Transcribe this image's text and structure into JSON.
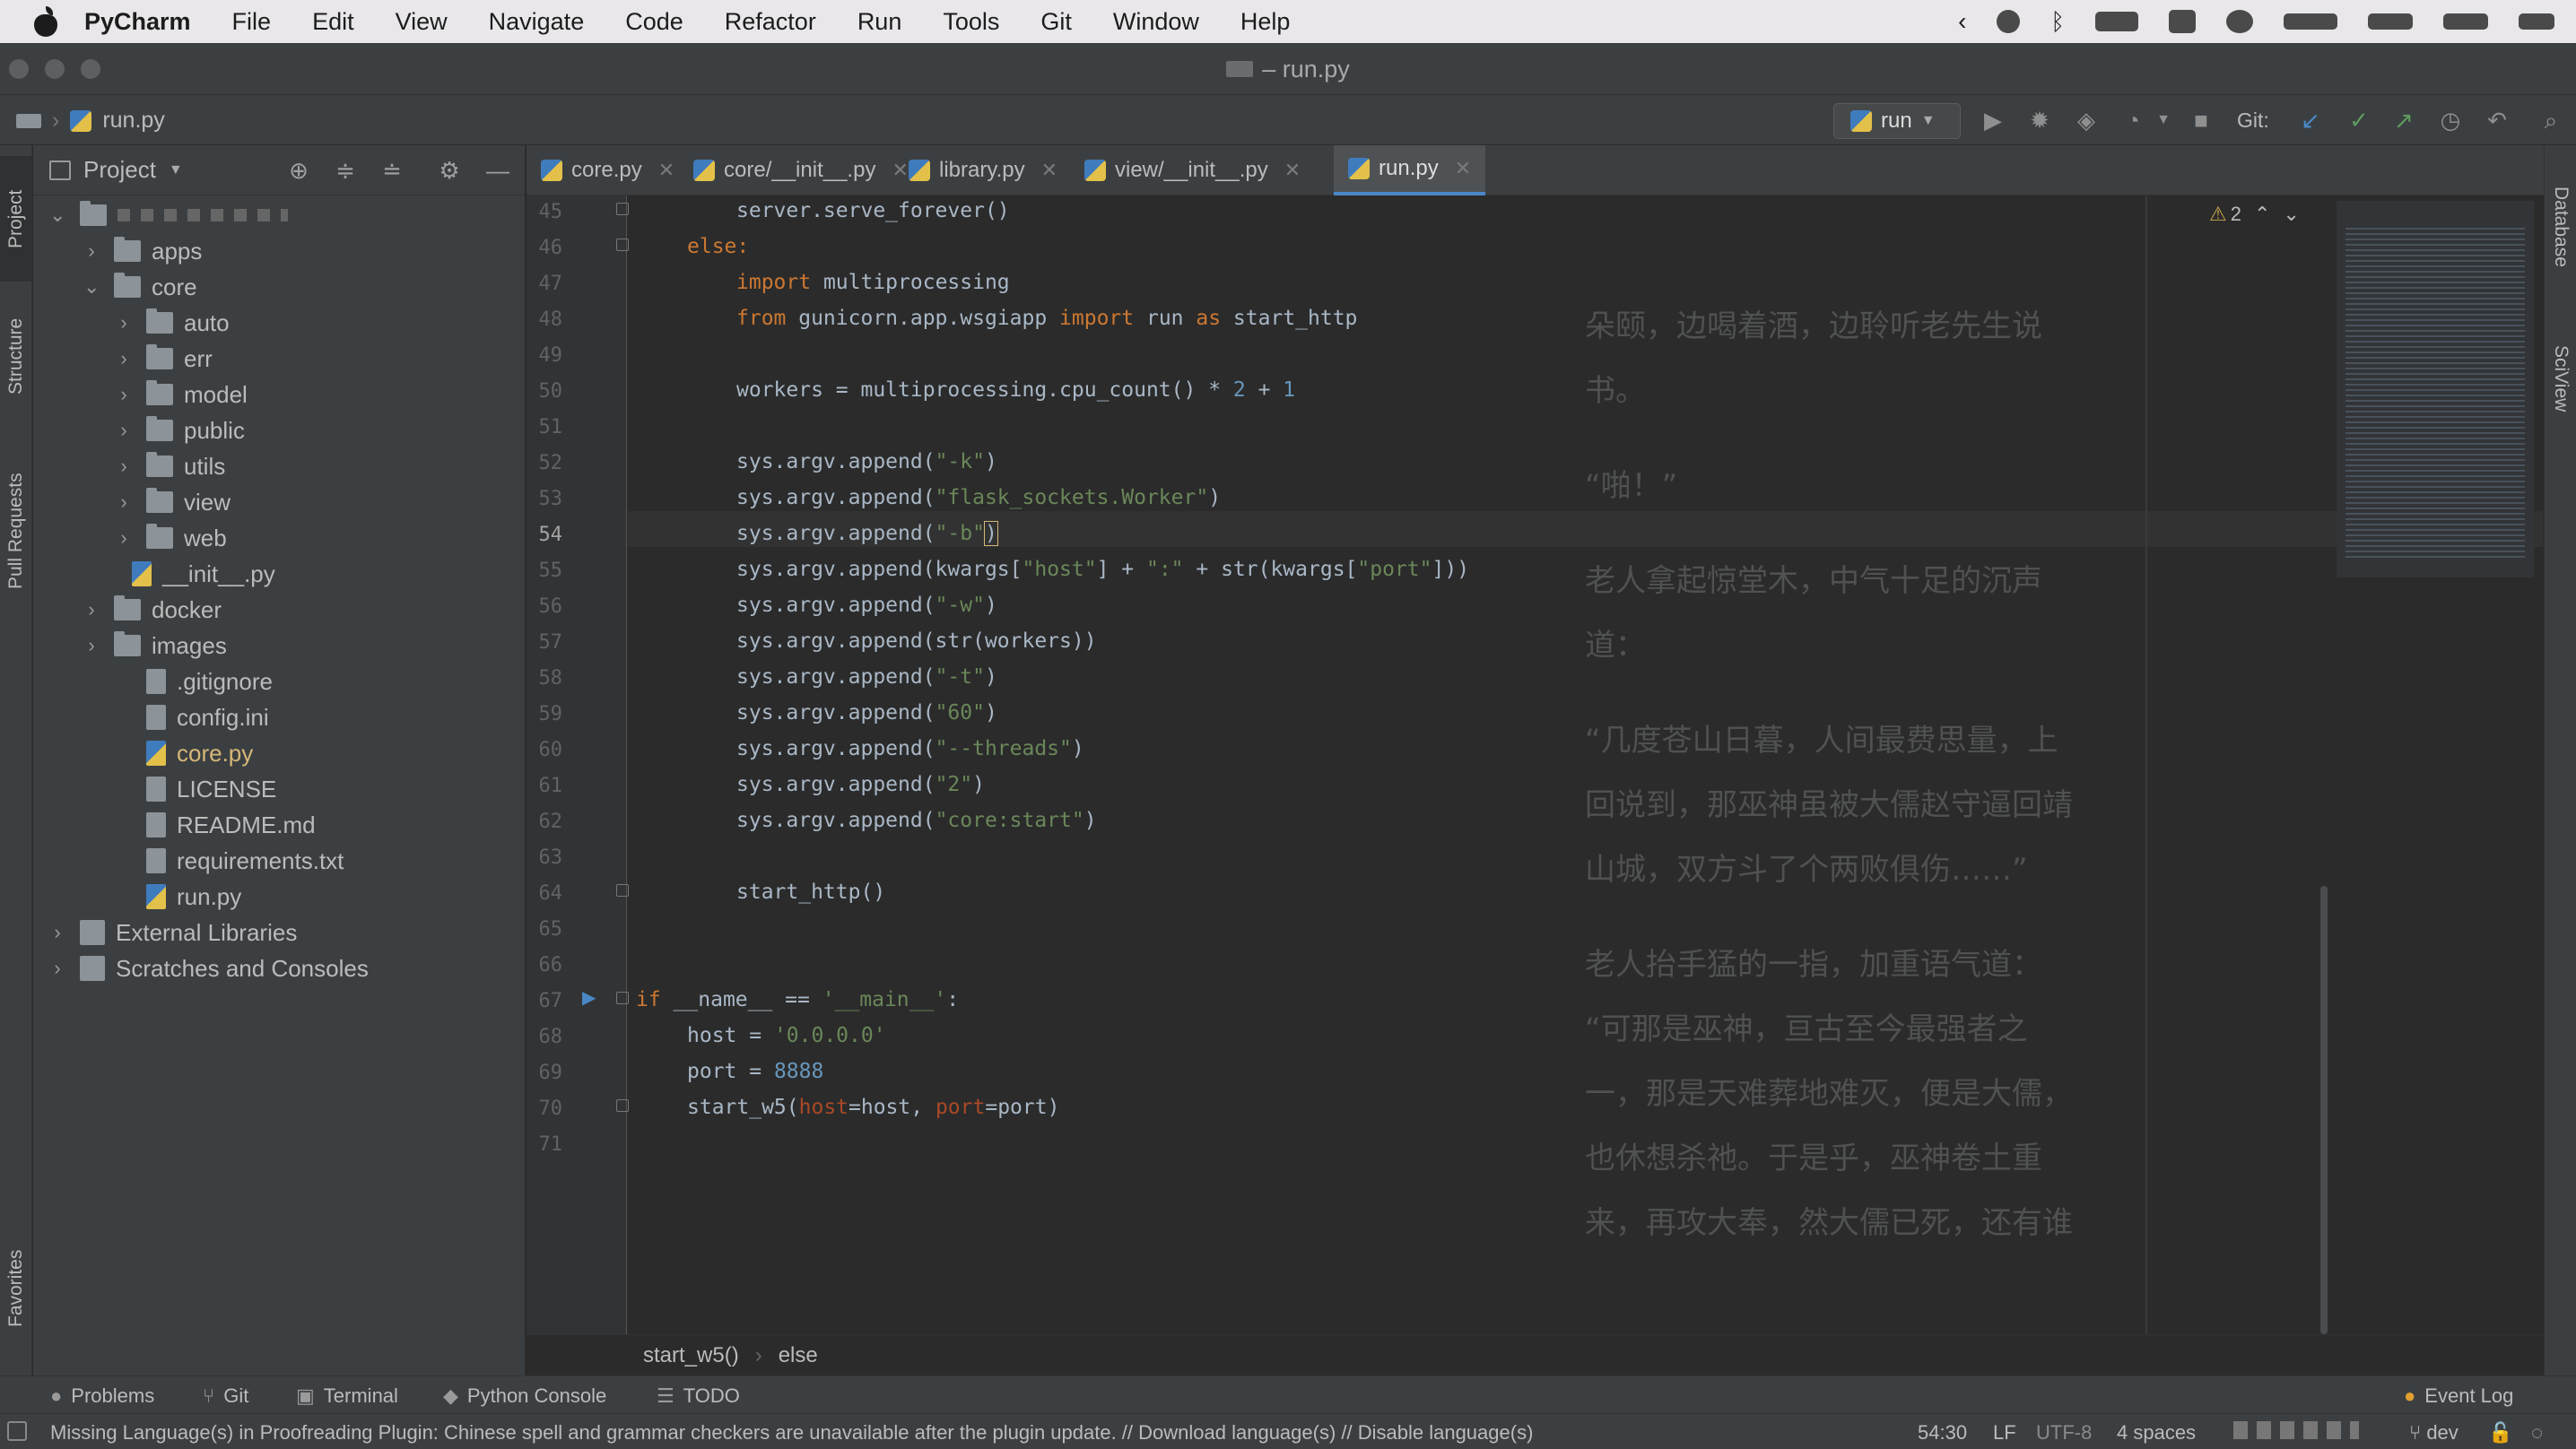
{
  "menubar": {
    "app": "PyCharm",
    "items": [
      "File",
      "Edit",
      "View",
      "Navigate",
      "Code",
      "Refactor",
      "Run",
      "Tools",
      "Git",
      "Window",
      "Help"
    ]
  },
  "window": {
    "title": "– run.py"
  },
  "navbar": {
    "crumb": "run.py",
    "run_config": "run",
    "git_label": "Git:"
  },
  "project": {
    "header": "Project",
    "tree": [
      {
        "label": "apps",
        "type": "folder",
        "depth": 1,
        "expanded": false
      },
      {
        "label": "core",
        "type": "folder",
        "depth": 1,
        "expanded": true
      },
      {
        "label": "auto",
        "type": "folder",
        "depth": 2,
        "expanded": false
      },
      {
        "label": "err",
        "type": "folder",
        "depth": 2,
        "expanded": false
      },
      {
        "label": "model",
        "type": "folder",
        "depth": 2,
        "expanded": false
      },
      {
        "label": "public",
        "type": "folder",
        "depth": 2,
        "expanded": false
      },
      {
        "label": "utils",
        "type": "folder",
        "depth": 2,
        "expanded": false
      },
      {
        "label": "view",
        "type": "folder",
        "depth": 2,
        "expanded": false
      },
      {
        "label": "web",
        "type": "folder",
        "depth": 2,
        "expanded": false
      },
      {
        "label": "__init__.py",
        "type": "py",
        "depth": 3
      },
      {
        "label": "docker",
        "type": "folder",
        "depth": 1,
        "expanded": false
      },
      {
        "label": "images",
        "type": "folder",
        "depth": 1,
        "expanded": false
      },
      {
        "label": ".gitignore",
        "type": "file",
        "depth": 2
      },
      {
        "label": "config.ini",
        "type": "file",
        "depth": 2
      },
      {
        "label": "core.py",
        "type": "py",
        "depth": 2,
        "modified": true
      },
      {
        "label": "LICENSE",
        "type": "file",
        "depth": 2
      },
      {
        "label": "README.md",
        "type": "file",
        "depth": 2
      },
      {
        "label": "requirements.txt",
        "type": "file",
        "depth": 2
      },
      {
        "label": "run.py",
        "type": "py",
        "depth": 2
      },
      {
        "label": "External Libraries",
        "type": "lib",
        "depth": 0,
        "expanded": false
      },
      {
        "label": "Scratches and Consoles",
        "type": "lib",
        "depth": 0,
        "expanded": false
      }
    ]
  },
  "tabs": [
    {
      "label": "core.py",
      "active": false
    },
    {
      "label": "core/__init__.py",
      "active": false
    },
    {
      "label": "library.py",
      "active": false
    },
    {
      "label": "view/__init__.py",
      "active": false
    },
    {
      "label": "run.py",
      "active": true
    }
  ],
  "editor": {
    "warnings": "2",
    "current_line": 54,
    "line_numbers": [
      45,
      46,
      47,
      48,
      49,
      50,
      51,
      52,
      53,
      54,
      55,
      56,
      57,
      58,
      59,
      60,
      61,
      62,
      63,
      64,
      65,
      66,
      67,
      68,
      69,
      70,
      71
    ],
    "overlay_text": [
      "朵颐，边喝着酒，边聆听老先生说",
      "书。",
      "“啪！”",
      "老人拿起惊堂木，中气十足的沉声",
      "道：",
      "“几度苍山日暮，人间最费思量，上",
      "回说到，那巫神虽被大儒赵守逼回靖",
      "山城，双方斗了个两败俱伤……”",
      "老人抬手猛的一指，加重语气道：",
      "“可那是巫神，亘古至今最强者之",
      "一，那是天难葬地难灭，便是大儒，",
      "也休想杀祂。于是乎，巫神卷土重",
      "来，再攻大奉，然大儒已死，还有谁"
    ]
  },
  "code_tokens": {
    "l45": "server.serve_forever()",
    "l46": "else:",
    "l47a": "import",
    "l47b": " multiprocessing",
    "l48a": "from",
    "l48b": " gunicorn.app.wsgiapp ",
    "l48c": "import",
    "l48d": " run ",
    "l48e": "as",
    "l48f": " start_http",
    "l50a": "workers = multiprocessing.cpu_count() * ",
    "l50b": "2",
    "l50c": " + ",
    "l50d": "1",
    "l52a": "sys.argv.append(",
    "l52b": "\"-k\"",
    "l52c": ")",
    "l53a": "sys.argv.append(",
    "l53b": "\"flask_sockets.Worker\"",
    "l53c": ")",
    "l54a": "sys.argv.append(",
    "l54b": "\"-b\"",
    "l54c": ")",
    "l55a": "sys.argv.append(kwargs[",
    "l55b": "\"host\"",
    "l55c": "] + ",
    "l55d": "\":\"",
    "l55e": " + str(kwargs[",
    "l55f": "\"port\"",
    "l55g": "]))",
    "l56a": "sys.argv.append(",
    "l56b": "\"-w\"",
    "l56c": ")",
    "l57": "sys.argv.append(str(workers))",
    "l58a": "sys.argv.append(",
    "l58b": "\"-t\"",
    "l58c": ")",
    "l59a": "sys.argv.append(",
    "l59b": "\"60\"",
    "l59c": ")",
    "l60a": "sys.argv.append(",
    "l60b": "\"--threads\"",
    "l60c": ")",
    "l61a": "sys.argv.append(",
    "l61b": "\"2\"",
    "l61c": ")",
    "l62a": "sys.argv.append(",
    "l62b": "\"core:start\"",
    "l62c": ")",
    "l64": "start_http()",
    "l67a": "if",
    "l67b": " __name__ == ",
    "l67c": "'__main__'",
    "l67d": ":",
    "l68a": "host = ",
    "l68b": "'0.0.0.0'",
    "l69a": "port = ",
    "l69b": "8888",
    "l70a": "start_w5(",
    "l70b": "host",
    "l70c": "=host, ",
    "l70d": "port",
    "l70e": "=port)"
  },
  "breadcrumbs": [
    "start_w5()",
    "else"
  ],
  "bottom_tools": [
    "Problems",
    "Git",
    "Terminal",
    "Python Console",
    "TODO"
  ],
  "event_log": "Event Log",
  "status": {
    "message": "Missing Language(s) in Proofreading Plugin: Chinese spell and grammar checkers are unavailable after the plugin update. // Download language(s) // Disable language(s)",
    "position": "54:30",
    "line_sep": "LF",
    "encoding": "UTF-8",
    "indent": "4 spaces",
    "branch": "dev"
  },
  "side_tabs": {
    "left": [
      "Project",
      "Structure",
      "Pull Requests",
      "Favorites"
    ],
    "right": [
      "Database",
      "SciView"
    ]
  },
  "colors": {
    "keyword": "#cc7832",
    "string": "#6a8759",
    "number": "#6897bb",
    "param": "#aa4926",
    "accent": "#4a88c7",
    "modified": "#d5b778"
  }
}
